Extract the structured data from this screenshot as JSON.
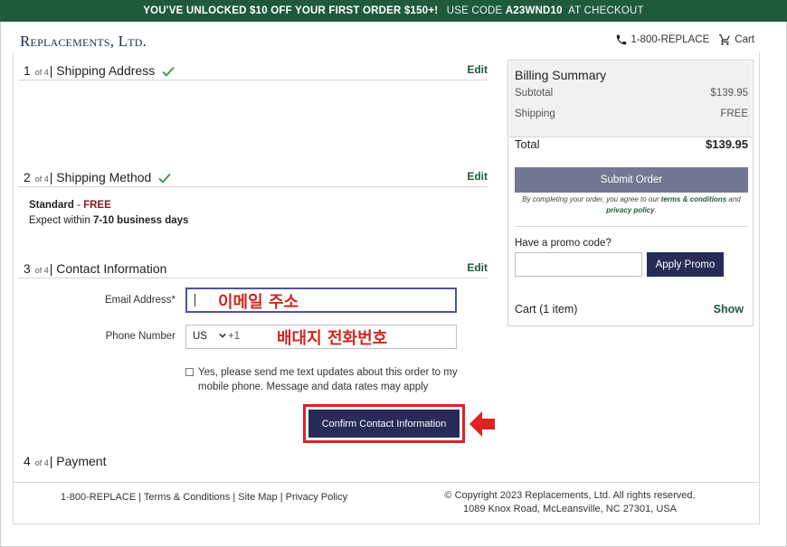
{
  "promo_bar": {
    "headline": "YOU'VE UNLOCKED $10 OFF YOUR FIRST ORDER $150+!",
    "code_prefix": "USE CODE",
    "code": "A23WND10",
    "code_suffix": "AT CHECKOUT"
  },
  "header": {
    "logo": "Replacements, Ltd.",
    "phone": "1-800-REPLACE",
    "cart": "Cart",
    "icons": {
      "phone": "phone-icon",
      "cart": "cart-icon"
    }
  },
  "steps": [
    {
      "num": "1",
      "of": "of 4",
      "title": "Shipping Address",
      "done": true,
      "edit": "Edit"
    },
    {
      "num": "2",
      "of": "of 4",
      "title": "Shipping Method",
      "done": true,
      "edit": "Edit"
    },
    {
      "num": "3",
      "of": "of 4",
      "title": "Contact Information",
      "done": false,
      "edit": "Edit"
    },
    {
      "num": "4",
      "of": "of 4",
      "title": "Payment",
      "done": false,
      "edit": ""
    }
  ],
  "shipping_method": {
    "name": "Standard",
    "sep": " - ",
    "price": "FREE",
    "eta_prefix": "Expect within ",
    "eta": "7-10 business days"
  },
  "contact_form": {
    "email_label": "Email Address",
    "email_required": "*",
    "email_value": "",
    "email_annotation": "이메일 주소",
    "phone_label": "Phone Number",
    "country": "US",
    "dial_code": "+1",
    "phone_value": "",
    "phone_annotation": "배대지 전화번호",
    "sms_opt_in": "Yes, please send me text updates about this order to my mobile phone. Message and data rates may apply",
    "sms_checked": false,
    "confirm_button": "Confirm Contact Information"
  },
  "billing_summary": {
    "title": "Billing Summary",
    "subtotal_label": "Subtotal",
    "subtotal": "$139.95",
    "shipping_label": "Shipping",
    "shipping": "FREE",
    "total_label": "Total",
    "total": "$139.95",
    "submit_button": "Submit Order",
    "terms_prefix": "By completing your order, you agree to our ",
    "terms_link": "terms & conditions",
    "terms_and": " and",
    "privacy_link": "privacy policy",
    "terms_end": ".",
    "promo_label": "Have a promo code?",
    "promo_value": "",
    "apply_button": "Apply Promo",
    "cart_title": "Cart (1 item)",
    "cart_show": "Show"
  },
  "footer": {
    "links": "1-800-REPLACE | Terms & Conditions | Site Map | Privacy Policy",
    "copyright": "© Copyright 2023 Replacements, Ltd. All rights reserved.",
    "address": "1089 Knox Road, McLeansville, NC 27301, USA"
  },
  "colors": {
    "brand_green": "#1f5a3b",
    "navy_button": "#262b57",
    "annotation_red": "#d0261f"
  }
}
